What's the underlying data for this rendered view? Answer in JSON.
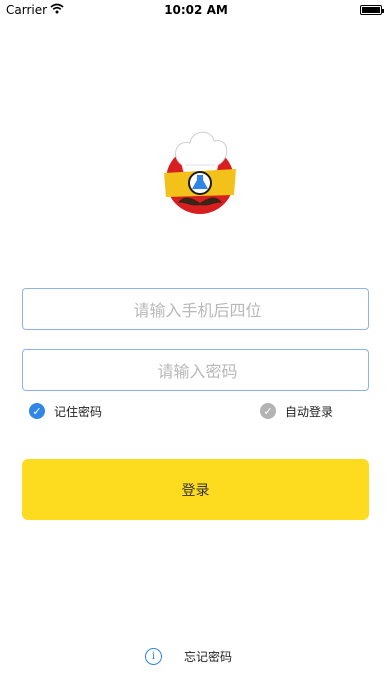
{
  "status_bar": {
    "carrier": "Carrier",
    "time": "10:02 AM",
    "wifi_icon": "wifi-icon",
    "battery_icon": "battery-icon"
  },
  "logo": {
    "icon": "chef-hat-mustache-logo",
    "colors": {
      "hat": "#ffffff",
      "band": "#f2c21a",
      "circle": "#d81e1e",
      "mustache": "#3a2416",
      "flask": "#2f86e6"
    }
  },
  "form": {
    "phone_placeholder": "请输入手机后四位",
    "password_placeholder": "请输入密码",
    "remember_label": "记住密码",
    "remember_checked": true,
    "autologin_label": "自动登录",
    "autologin_checked": false,
    "login_button": "登录"
  },
  "footer": {
    "forgot_label": "忘记密码",
    "info_icon": "info-icon"
  },
  "colors": {
    "accent": "#2f86e6",
    "button": "#fddb1f",
    "field_border": "#8fb3e8",
    "disabled": "#b3b3b3"
  }
}
